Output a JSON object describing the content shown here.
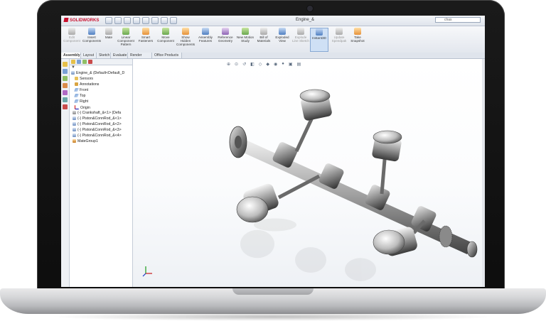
{
  "app": {
    "logo_text": "SOLIDWORKS",
    "document_title": "Engine_&",
    "search_placeholder": "chas"
  },
  "ribbon": {
    "buttons": [
      {
        "label": "Edit Component",
        "icon": "edit-component-icon",
        "state": "dim"
      },
      {
        "label": "Insert Components",
        "icon": "insert-components-icon"
      },
      {
        "label": "Mate",
        "icon": "mate-icon"
      },
      {
        "label": "Linear Component Pattern",
        "icon": "linear-pattern-icon"
      },
      {
        "label": "Smart Fasteners",
        "icon": "smart-fasteners-icon"
      },
      {
        "label": "Move Component",
        "icon": "move-component-icon"
      },
      {
        "label": "Show Hidden Components",
        "icon": "show-hidden-icon"
      },
      {
        "label": "Assembly Features",
        "icon": "assembly-features-icon"
      },
      {
        "label": "Reference Geometry",
        "icon": "reference-geometry-icon"
      },
      {
        "label": "New Motion Study",
        "icon": "motion-study-icon"
      },
      {
        "label": "Bill of Materials",
        "icon": "bom-icon"
      },
      {
        "label": "Exploded View",
        "icon": "exploded-view-icon"
      },
      {
        "label": "Explode Line Sketch",
        "icon": "explode-line-icon",
        "state": "dim"
      },
      {
        "label": "Instant3D",
        "icon": "instant3d-icon",
        "state": "active"
      },
      {
        "label": "Update Speedpak",
        "icon": "speedpak-icon",
        "state": "dim"
      },
      {
        "label": "Take Snapshot",
        "icon": "snapshot-icon"
      }
    ]
  },
  "tabs": [
    {
      "label": "Assembly",
      "active": true
    },
    {
      "label": "Layout"
    },
    {
      "label": "Sketch"
    },
    {
      "label": "Evaluate"
    },
    {
      "label": "Render Tools"
    },
    {
      "label": "Office Products"
    }
  ],
  "feature_tree": {
    "items": [
      {
        "label": "Engine_& (Default<Default_D",
        "icon": "assembly-icon"
      },
      {
        "label": "Sensors",
        "icon": "sensors-icon"
      },
      {
        "label": "Annotations",
        "icon": "annotations-icon"
      },
      {
        "label": "Front",
        "icon": "plane-icon"
      },
      {
        "label": "Top",
        "icon": "plane-icon"
      },
      {
        "label": "Right",
        "icon": "plane-icon"
      },
      {
        "label": "Origin",
        "icon": "origin-icon"
      },
      {
        "label": "(-) Crankshaft_&<1> (Defa",
        "icon": "part-icon"
      },
      {
        "label": "(-) Piston&ConnRod_&<1>",
        "icon": "subassembly-icon"
      },
      {
        "label": "(-) Piston&ConnRod_&<2>",
        "icon": "subassembly-icon"
      },
      {
        "label": "(-) Piston&ConnRod_&<3>",
        "icon": "subassembly-icon"
      },
      {
        "label": "(-) Piston&ConnRod_&<4>",
        "icon": "subassembly-icon"
      },
      {
        "label": "MateGroup1",
        "icon": "mate-group-icon"
      }
    ]
  },
  "colors": {
    "accent": "#c8102e",
    "ribbon_active": "#cfe0f5",
    "part_metal": "#8c8c8c"
  }
}
